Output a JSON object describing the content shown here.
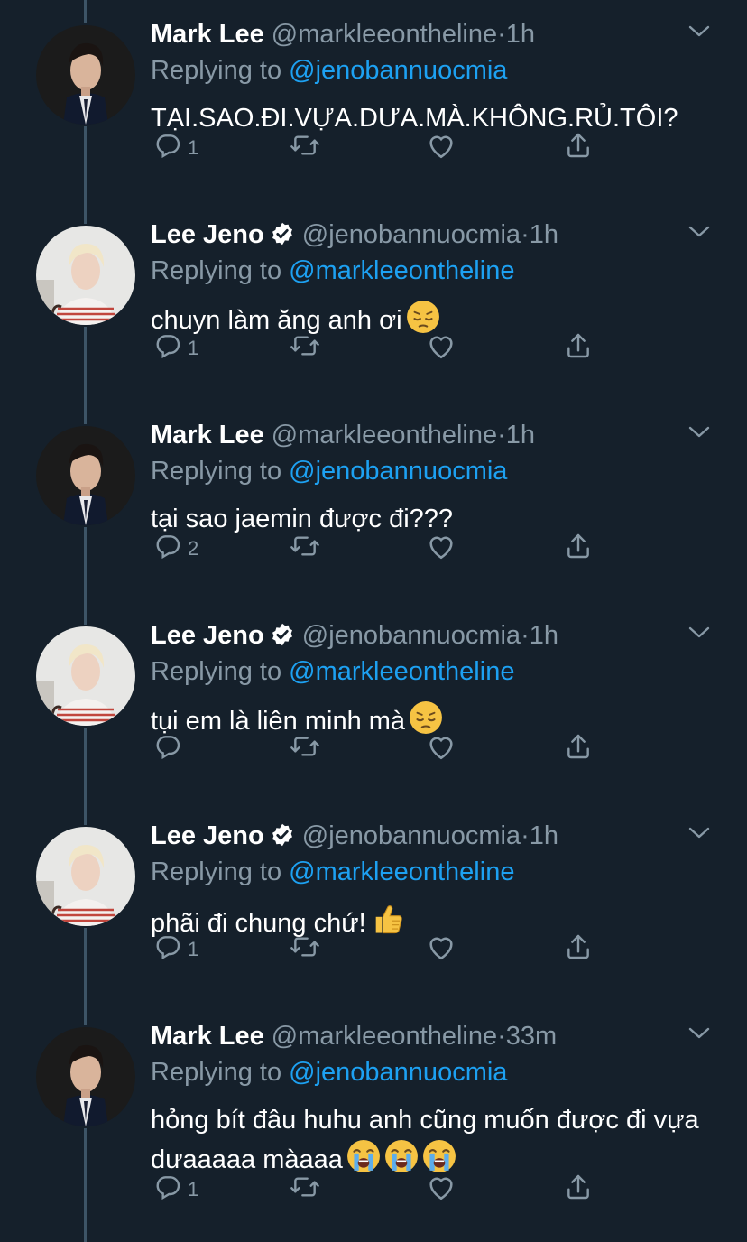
{
  "colors": {
    "background": "#15202b",
    "muted": "#8899a6",
    "link": "#1da1f2",
    "thread_line": "#3d5466"
  },
  "replying_prefix": "Replying to",
  "tweets": [
    {
      "name": "Mark Lee",
      "verified": false,
      "handle": "@markleeontheline",
      "time": "1h",
      "replying_to": "@jenobannuocmia",
      "text": "TẠI.SAO.ĐI.VỰA.DƯA.MÀ.KHÔNG.RỦ.TÔI?",
      "emoji": [],
      "reply_count": "1",
      "avatar": "mark"
    },
    {
      "name": "Lee Jeno",
      "verified": true,
      "handle": "@jenobannuocmia",
      "time": "1h",
      "replying_to": "@markleeontheline",
      "text": "chuyn làm ăng anh ơi",
      "emoji": [
        "pensive-face"
      ],
      "reply_count": "1",
      "avatar": "jeno"
    },
    {
      "name": "Mark Lee",
      "verified": false,
      "handle": "@markleeontheline",
      "time": "1h",
      "replying_to": "@jenobannuocmia",
      "text": "tại sao jaemin được đi???",
      "emoji": [],
      "reply_count": "2",
      "avatar": "mark"
    },
    {
      "name": "Lee Jeno",
      "verified": true,
      "handle": "@jenobannuocmia",
      "time": "1h",
      "replying_to": "@markleeontheline",
      "text": "tụi em là liên minh mà",
      "emoji": [
        "pensive-face"
      ],
      "reply_count": "",
      "avatar": "jeno"
    },
    {
      "name": "Lee Jeno",
      "verified": true,
      "handle": "@jenobannuocmia",
      "time": "1h",
      "replying_to": "@markleeontheline",
      "text": "phãi đi chung chứ!",
      "emoji": [
        "thumbs-up"
      ],
      "reply_count": "1",
      "avatar": "jeno"
    },
    {
      "name": "Mark Lee",
      "verified": false,
      "handle": "@markleeontheline",
      "time": "33m",
      "replying_to": "@jenobannuocmia",
      "text": "hỏng bít đâu huhu anh cũng muốn được đi vựa dưaaaaa màaaa",
      "emoji": [
        "loudly-crying-face",
        "loudly-crying-face",
        "loudly-crying-face"
      ],
      "reply_count": "1",
      "avatar": "mark"
    }
  ],
  "icons": {
    "reply": "reply-icon",
    "retweet": "retweet-icon",
    "like": "heart-icon",
    "share": "share-icon",
    "caret": "chevron-down-icon",
    "verified": "verified-badge-icon"
  }
}
